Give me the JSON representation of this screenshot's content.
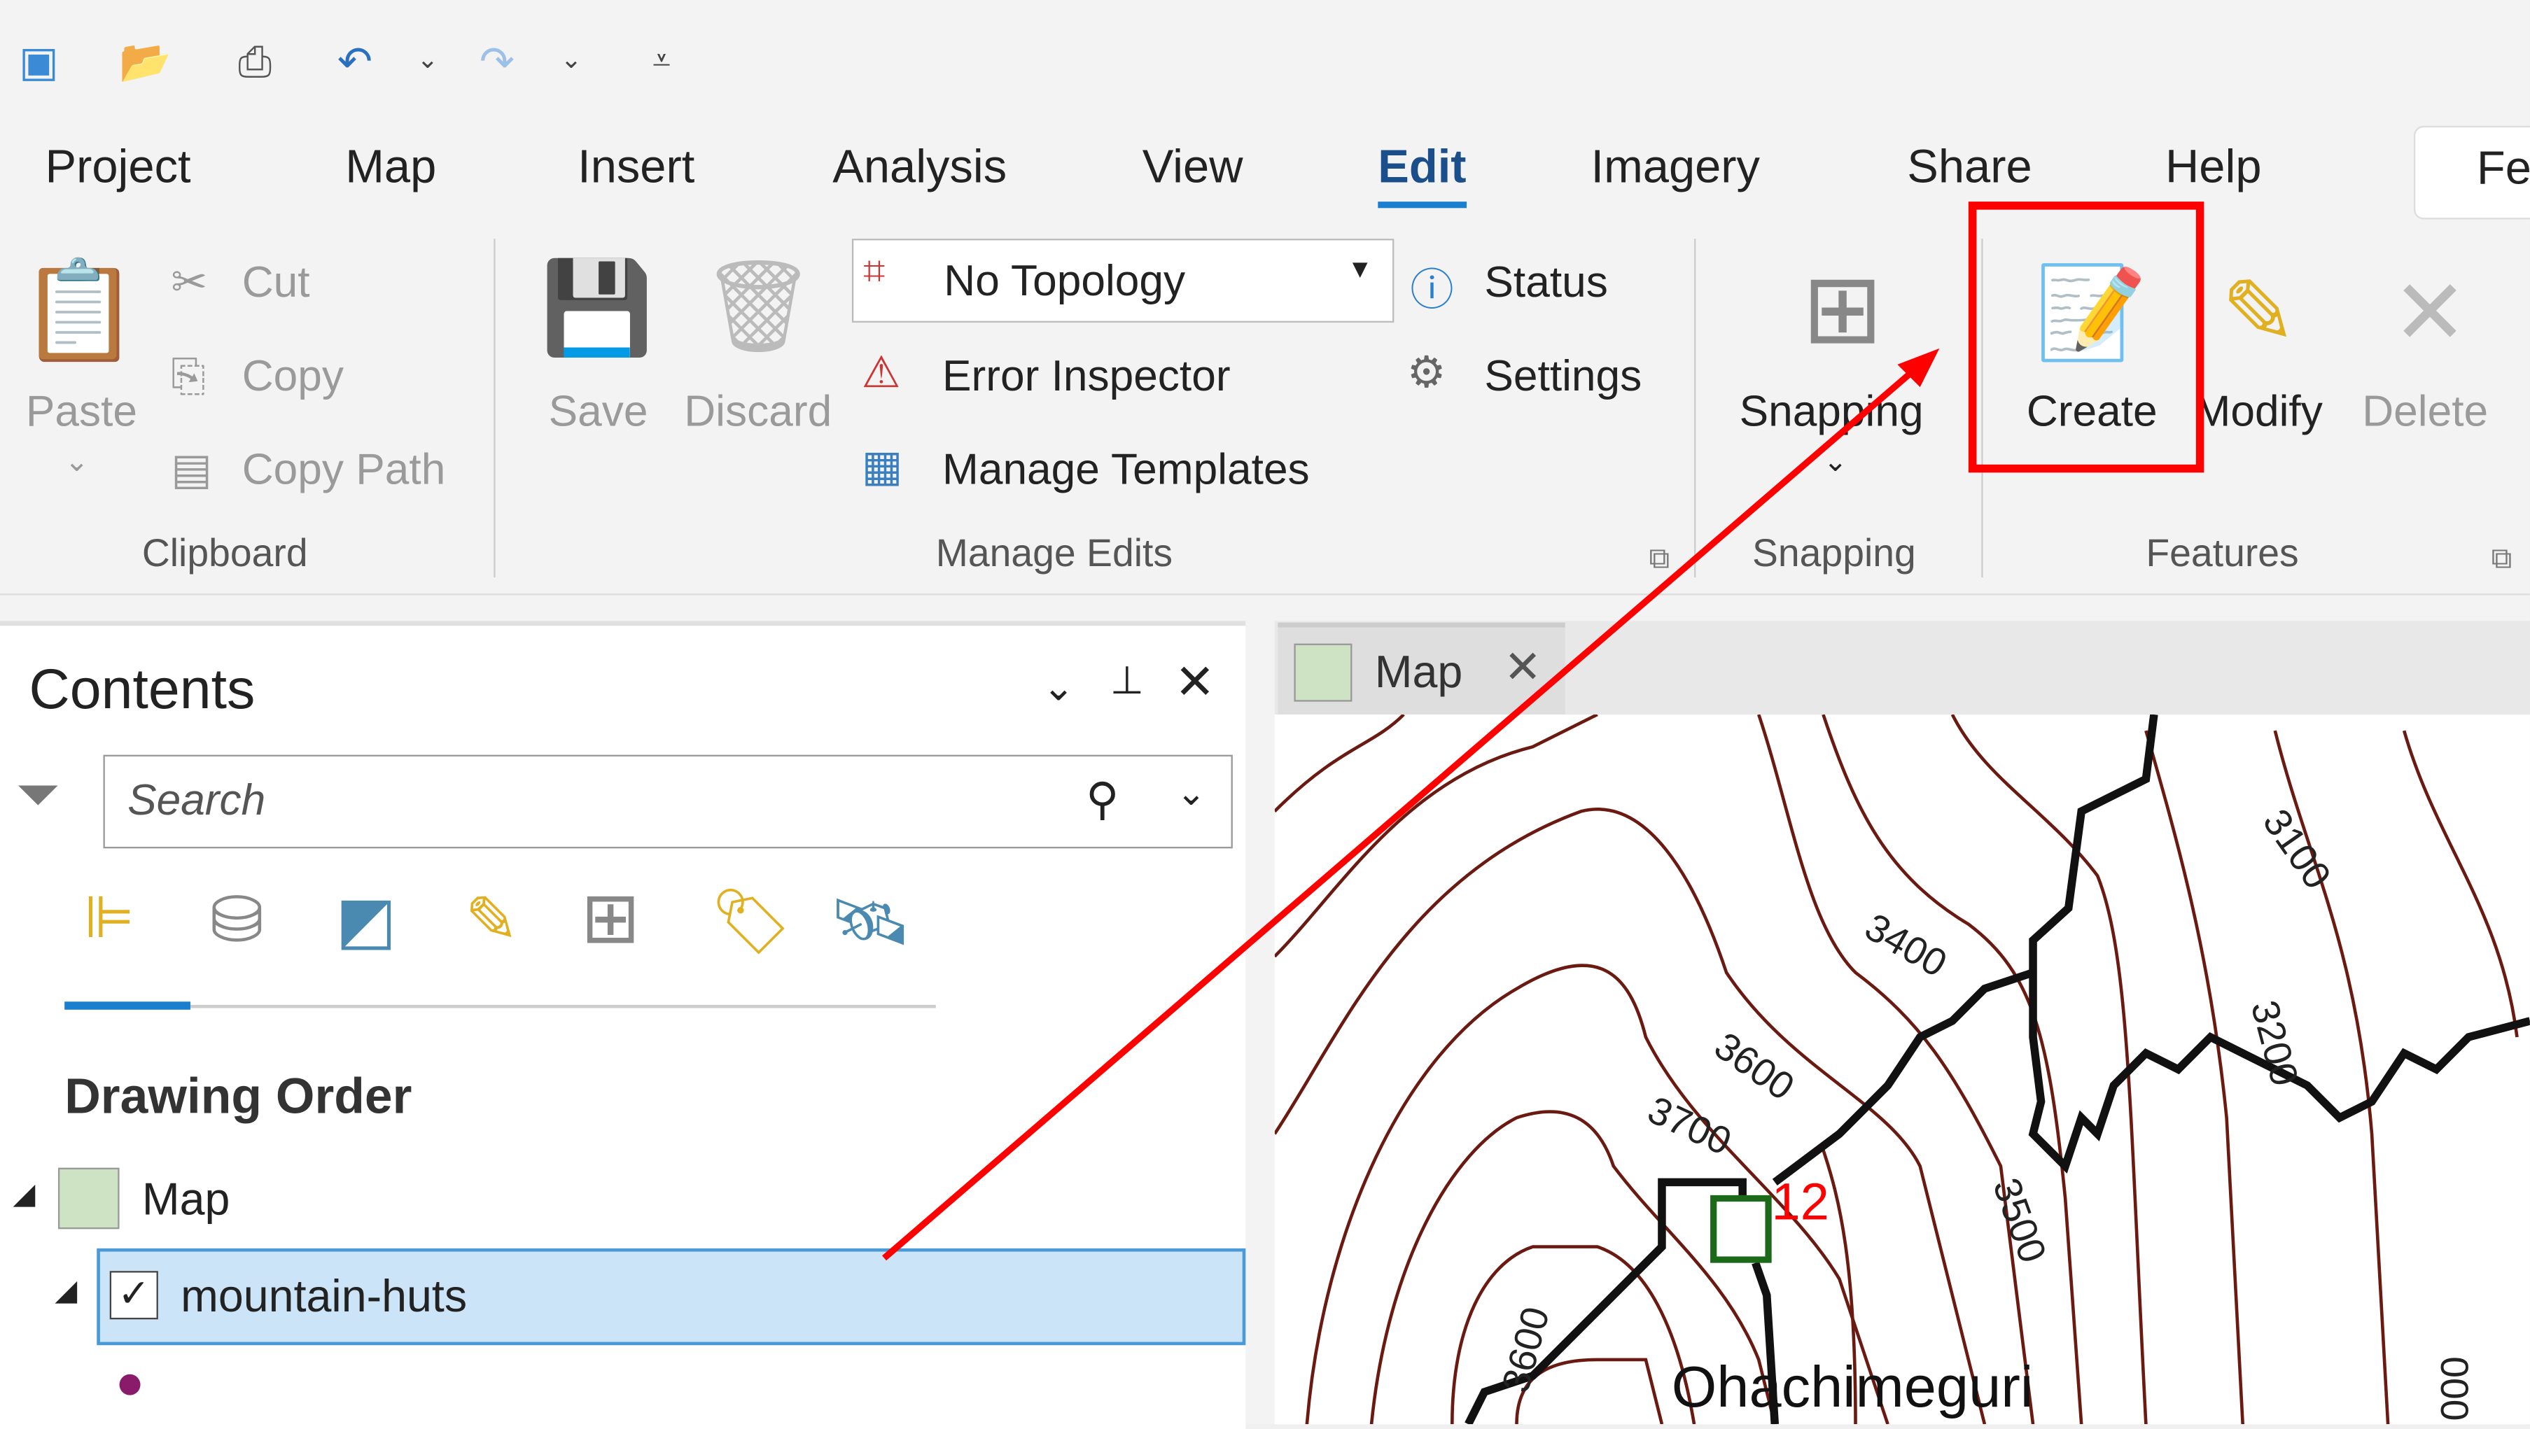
{
  "quick_access": {
    "icons": [
      "new-project-icon",
      "open-project-icon",
      "print-icon",
      "undo-icon",
      "undo-dropdown-icon",
      "redo-icon",
      "redo-dropdown-icon",
      "customize-qat-icon"
    ]
  },
  "tabs": [
    {
      "label": "Project"
    },
    {
      "label": "Map"
    },
    {
      "label": "Insert"
    },
    {
      "label": "Analysis"
    },
    {
      "label": "View"
    },
    {
      "label": "Edit",
      "active": true
    },
    {
      "label": "Imagery"
    },
    {
      "label": "Share"
    },
    {
      "label": "Help"
    },
    {
      "label": "Fe"
    }
  ],
  "ribbon": {
    "clipboard": {
      "group": "Clipboard",
      "paste": "Paste",
      "cut": "Cut",
      "copy": "Copy",
      "copy_path": "Copy Path"
    },
    "manage_edits": {
      "group": "Manage Edits",
      "save": "Save",
      "discard": "Discard",
      "topology": "No Topology",
      "error_inspector": "Error Inspector",
      "manage_templates": "Manage Templates",
      "status": "Status",
      "settings": "Settings"
    },
    "snapping": {
      "group": "Snapping",
      "label": "Snapping"
    },
    "features": {
      "group": "Features",
      "create": "Create",
      "modify": "Modify",
      "delete": "Delete"
    }
  },
  "contents": {
    "title": "Contents",
    "search_placeholder": "Search",
    "section": "Drawing Order",
    "map_item": "Map",
    "layer": "mountain-huts",
    "layer_checked": true
  },
  "map_view": {
    "tab": "Map",
    "contour_labels": [
      "3100",
      "3400",
      "3600",
      "3700",
      "3500",
      "3200",
      "3600",
      "000"
    ],
    "hut_number": "12",
    "place_name": "Ohachimeguri"
  },
  "annotation": {
    "color": "#ff0000"
  },
  "colors": {
    "accent": "#1b7fd0",
    "contour": "#6b1a12",
    "selection": "#cce4f7"
  }
}
